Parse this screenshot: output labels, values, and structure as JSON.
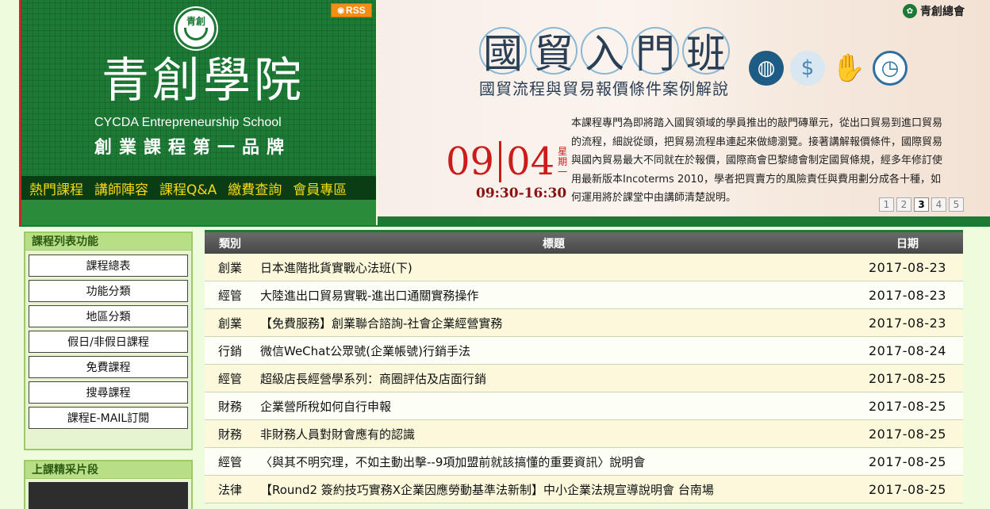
{
  "brand": {
    "logo_mark": "青創",
    "title": "青創學院",
    "english_name": "CYCDA Entrepreneurship School",
    "slogan": "創業課程第一品牌",
    "rss_label": "RSS",
    "nav": [
      "熱門課程",
      "講師陣容",
      "課程Q&A",
      "繳費查詢",
      "會員專區"
    ]
  },
  "banner": {
    "org_name": "青創總會",
    "title_chars": [
      "國",
      "貿",
      "入",
      "門",
      "班"
    ],
    "subtitle": "國貿流程與貿易報價條件案例解說",
    "description": "本課程專門為即將踏入國貿領域的學員推出的敲門磚單元，從出口貿易到進口貿易的流程，細說從頭，把貿易流程串連起來做總瀏覽。接著講解報價條件，國際貿易與國內貿易最大不同就在於報價，國際商會巴黎總會制定國貿條規，經多年修訂使用最新版本Incoterms 2010，學者把買賣方的風險責任與費用劃分成各十種，如何運用將於課堂中由講師清楚說明。",
    "date_month": "09",
    "date_day": "04",
    "weekday": "星期一",
    "time": "09:30-16:30",
    "pager": [
      "1",
      "2",
      "3",
      "4",
      "5"
    ],
    "pager_active": "3",
    "icons": [
      "globe-icon",
      "money-icon",
      "handshake-icon",
      "clock-icon"
    ]
  },
  "sidebar": {
    "func_header": "課程列表功能",
    "items": [
      "課程總表",
      "功能分類",
      "地區分類",
      "假日/非假日課程",
      "免費課程",
      "搜尋課程",
      "課程E-MAIL訂閱"
    ],
    "video_header": "上課精采片段"
  },
  "table": {
    "headers": {
      "category": "類別",
      "title": "標題",
      "date": "日期"
    },
    "rows": [
      {
        "category": "創業",
        "title": "日本進階批貨實戰心法班(下)",
        "date": "2017-08-23"
      },
      {
        "category": "經管",
        "title": "大陸進出口貿易實戰-進出口通關實務操作",
        "date": "2017-08-23"
      },
      {
        "category": "創業",
        "title": "【免費服務】創業聯合諮詢-社會企業經營實務",
        "date": "2017-08-23"
      },
      {
        "category": "行銷",
        "title": "微信WeChat公眾號(企業帳號)行銷手法",
        "date": "2017-08-24"
      },
      {
        "category": "經管",
        "title": "超級店長經營學系列：商圈評估及店面行銷",
        "date": "2017-08-25"
      },
      {
        "category": "財務",
        "title": "企業營所稅如何自行申報",
        "date": "2017-08-25"
      },
      {
        "category": "財務",
        "title": "非財務人員對財會應有的認識",
        "date": "2017-08-25"
      },
      {
        "category": "經管",
        "title": "〈與其不明究理，不如主動出擊--9項加盟前就該搞懂的重要資訊〉說明會",
        "date": "2017-08-25"
      },
      {
        "category": "法律",
        "title": "【Round2 簽約技巧實務X企業因應勞動基準法新制】中小企業法規宣導說明會 台南場",
        "date": "2017-08-25"
      }
    ]
  },
  "colors": {
    "brand_green": "#1c7a35",
    "nav_yellow": "#f6d915",
    "date_red": "#cc1b1b"
  }
}
